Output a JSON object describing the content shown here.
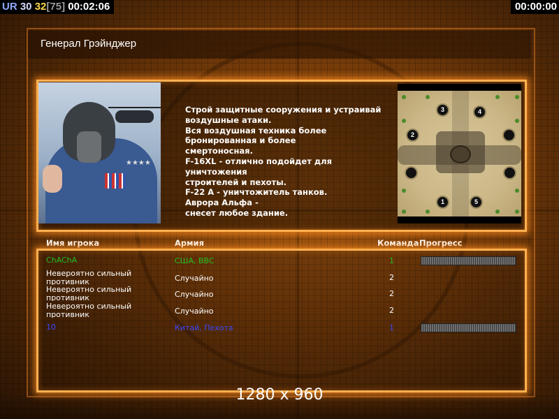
{
  "hud": {
    "faction": "UR",
    "value1": "30",
    "value2": "32",
    "value3": "[75]",
    "timer": "00:02:06",
    "timer_right": "00:00:00"
  },
  "general": {
    "title": "Генерал Грэйнджер",
    "description": "Строй защитные сооружения и устраивай\n воздушные атаки.\nВся воздушная техника более\n бронированная и более\nсмертоносная.\nF-16XL - отлично подойдет для уничтожения\n строителей и пехоты.\nF-22 A - уничтожитель танков.\nАврора Альфа -\nснесет любое здание."
  },
  "minimap": {
    "spawns": [
      "1",
      "2",
      "3",
      "4",
      "5",
      "",
      "",
      ""
    ]
  },
  "table": {
    "headers": {
      "name": "Имя игрока",
      "army": "Армия",
      "team": "Команда",
      "progress": "Прогресс"
    },
    "rows": [
      {
        "name": "ChAChA",
        "army": "США, ВВС",
        "team": "1",
        "color": "#22c022",
        "progress": 1.0
      },
      {
        "name": "Невероятно сильный противник",
        "army": "Случайно",
        "team": "2",
        "color": "#ffffff"
      },
      {
        "name": "Невероятно сильный противник",
        "army": "Случайно",
        "team": "2",
        "color": "#ffffff"
      },
      {
        "name": "Невероятно сильный противник",
        "army": "Случайно",
        "team": "2",
        "color": "#ffffff"
      },
      {
        "name": "10",
        "army": "Китай, Пехота",
        "team": "1",
        "color": "#3a48ff",
        "progress": 1.0
      }
    ]
  },
  "resolution": "1280 x 960"
}
